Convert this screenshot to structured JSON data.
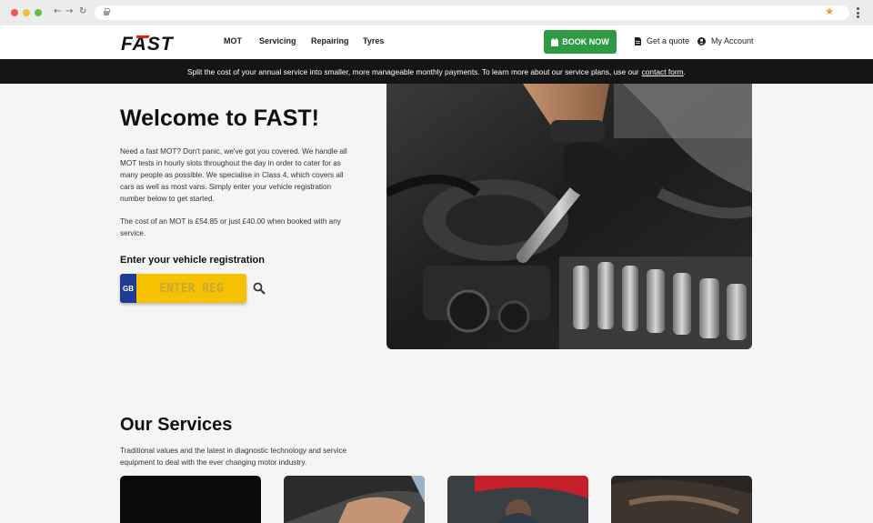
{
  "header": {
    "logo_text": "FAST",
    "nav": [
      "MOT",
      "Servicing",
      "Repairing",
      "Tyres"
    ],
    "book_label": "BOOK NOW",
    "quote_label": "Get a quote",
    "account_label": "My Account"
  },
  "banner": {
    "text": "Split the cost of your annual service into smaller, more manageable monthly payments. To learn more about our service plans, use our",
    "link": "contact form",
    "suffix": "."
  },
  "hero": {
    "title": "Welcome to FAST!",
    "paragraph1": "Need a fast MOT? Don't panic, we've got you covered. We handle all MOT tests in hourly slots throughout the day in order to cater for as many people as possible. We specialise in Class 4, which covers all cars as well as most vans. Simply enter your vehicle registration number below to get started.",
    "paragraph2": "The cost of an MOT is £54.85 or just £40.00 when booked with any service.",
    "reg_label": "Enter your vehicle registration",
    "plate_country": "GB",
    "reg_placeholder": "ENTER REG"
  },
  "services": {
    "title": "Our Services",
    "description": "Traditional values and the latest in diagnostic technology and service equipment to deal with the ever changing motor industry."
  },
  "colors": {
    "brand_red": "#e32119",
    "book_green": "#2e9a44",
    "plate_yellow": "#f6c100",
    "plate_blue": "#1e3c96",
    "banner_bg": "#151515"
  },
  "icons": [
    "lock-icon",
    "star-icon",
    "menu-dots-icon",
    "calendar-icon",
    "document-icon",
    "user-icon",
    "search-icon"
  ]
}
